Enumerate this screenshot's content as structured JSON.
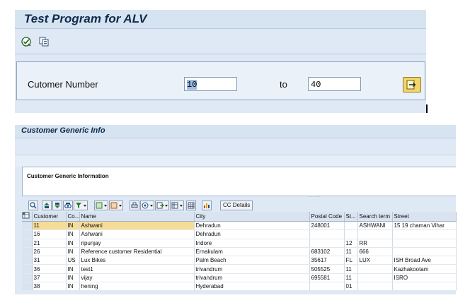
{
  "header": {
    "title": "Test Program for ALV",
    "toolbar": [
      {
        "icon": "execute-check-icon"
      },
      {
        "icon": "variant-copy-icon"
      }
    ]
  },
  "selection": {
    "label": "Cutomer Number",
    "from_value": "10",
    "to_label": "to",
    "to_value": "40",
    "multiple_selection_icon": "arrow-right-icon"
  },
  "output": {
    "title": "Customer Generic Info",
    "panel_text": "Customer Generic Information",
    "grid_toolbar": {
      "cc_details_label": "CC Details"
    },
    "columns": [
      "Customer",
      "Co...",
      "Name",
      "City",
      "Postal Code",
      "St...",
      "Search term",
      "Street"
    ],
    "rows": [
      [
        "11",
        "IN",
        "Ashwani",
        "Dehradun",
        "248001",
        "",
        "ASHWANI",
        "15 19 chaman Vihar"
      ],
      [
        "16",
        "IN",
        "Ashwani",
        "Dehradun",
        "",
        "",
        "",
        ""
      ],
      [
        "21",
        "IN",
        "ripunjay",
        "Indore",
        "",
        "12",
        "RR",
        ""
      ],
      [
        "26",
        "IN",
        "Reference customer Residential",
        "Ernakulam",
        "683102",
        "11",
        "666",
        ""
      ],
      [
        "31",
        "US",
        "Lux Bikes",
        "Palm Beach",
        "35617",
        "FL",
        "LUX",
        "ISH Broad Ave"
      ],
      [
        "36",
        "IN",
        "test1",
        "trivandrum",
        "505525",
        "11",
        "",
        "Kazhakootam"
      ],
      [
        "37",
        "IN",
        "vijay",
        "trivandrum",
        "695581",
        "11",
        "",
        "ISRO"
      ],
      [
        "38",
        "IN",
        "hening",
        "Hyderabad",
        "",
        "01",
        "",
        ""
      ]
    ]
  },
  "colors": {
    "title_text": "#0f2a4a",
    "panel_bg": "#dfe9f5",
    "highlight_cell": "#f6dc96",
    "execute_button": "#f4d66a"
  }
}
